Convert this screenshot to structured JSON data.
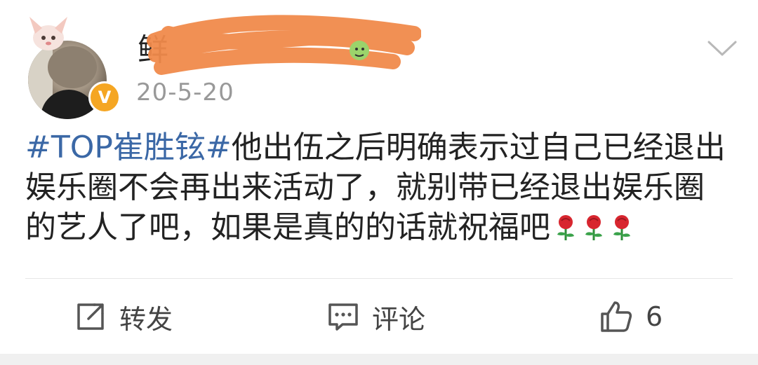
{
  "header": {
    "username": "鲜",
    "date": "20-5-20"
  },
  "post": {
    "hashtag": "#TOP崔胜铉#",
    "text": "他出伍之后明确表示过自己已经退出娱乐圈不会再出来活动了，就别带已经退出娱乐圈的艺人了吧，如果是真的的话就祝福吧",
    "emoji": [
      "rose",
      "rose",
      "rose"
    ]
  },
  "actions": {
    "repost_label": "转发",
    "comment_label": "评论",
    "like_count": "6"
  },
  "colors": {
    "hashtag": "#3b68a6",
    "verified_badge": "#f5a623",
    "redaction_scribble": "#f08a4b",
    "date": "#999999"
  },
  "icons": [
    "verified-badge-icon",
    "chevron-down-icon",
    "repost-icon",
    "comment-icon",
    "like-icon",
    "rose-emoji"
  ]
}
